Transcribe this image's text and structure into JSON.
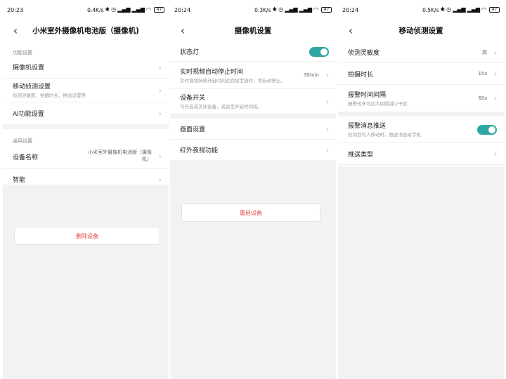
{
  "colors": {
    "accent": "#31a7a3",
    "danger": "#e4473d",
    "background_gray": "#f2f2f2"
  },
  "screens": [
    {
      "status": {
        "time": "20:23",
        "speed": "0.4K/s",
        "battery": "47"
      },
      "title": "小米室外摄像机电池版（摄像机)",
      "sections": [
        {
          "header": "功能设置",
          "rows": [
            {
              "label": "摄像机设置"
            },
            {
              "label": "移动侦测设置",
              "sub": "侦测灵敏度、拍摄时长、推送设置等"
            },
            {
              "label": "AI功能设置"
            }
          ]
        },
        {
          "header": "通用设置",
          "rows": [
            {
              "label": "设备名称",
              "value": "小米室外摄像机电池版（摄像机）"
            },
            {
              "label": "智能"
            }
          ]
        }
      ],
      "button": "删除设备"
    },
    {
      "status": {
        "time": "20:24",
        "speed": "0.3K/s",
        "battery": "47"
      },
      "title": "摄像机设置",
      "rows": [
        {
          "label": "状态灯",
          "toggle": "on"
        },
        {
          "label": "实时视频自动停止时间",
          "sub": "实时视频持续开启时间达到设定值时，将自动停止。",
          "value": "30min"
        },
        {
          "label": "设备开关",
          "sub": "可开启或关闭设备，或设定开启时间段。"
        },
        {
          "label": "画面设置"
        },
        {
          "label": "红外夜视功能"
        }
      ],
      "button": "重启设备"
    },
    {
      "status": {
        "time": "20:24",
        "speed": "0.5K/s",
        "battery": "47"
      },
      "title": "移动侦测设置",
      "rows": [
        {
          "label": "侦测灵敏度",
          "value": "高"
        },
        {
          "label": "拍摄时长",
          "value": "15s"
        },
        {
          "label": "报警时间间隔",
          "sub": "报警较多可拉大间隔减少干扰",
          "value": "60s"
        },
        {
          "label": "报警消息推送",
          "sub": "检测到有人移动时，推送消息给手机",
          "toggle": "on"
        },
        {
          "label": "推送类型"
        }
      ]
    }
  ],
  "icons": {
    "back": "chevron-left-icon",
    "chevron": "chevron-right-icon"
  }
}
